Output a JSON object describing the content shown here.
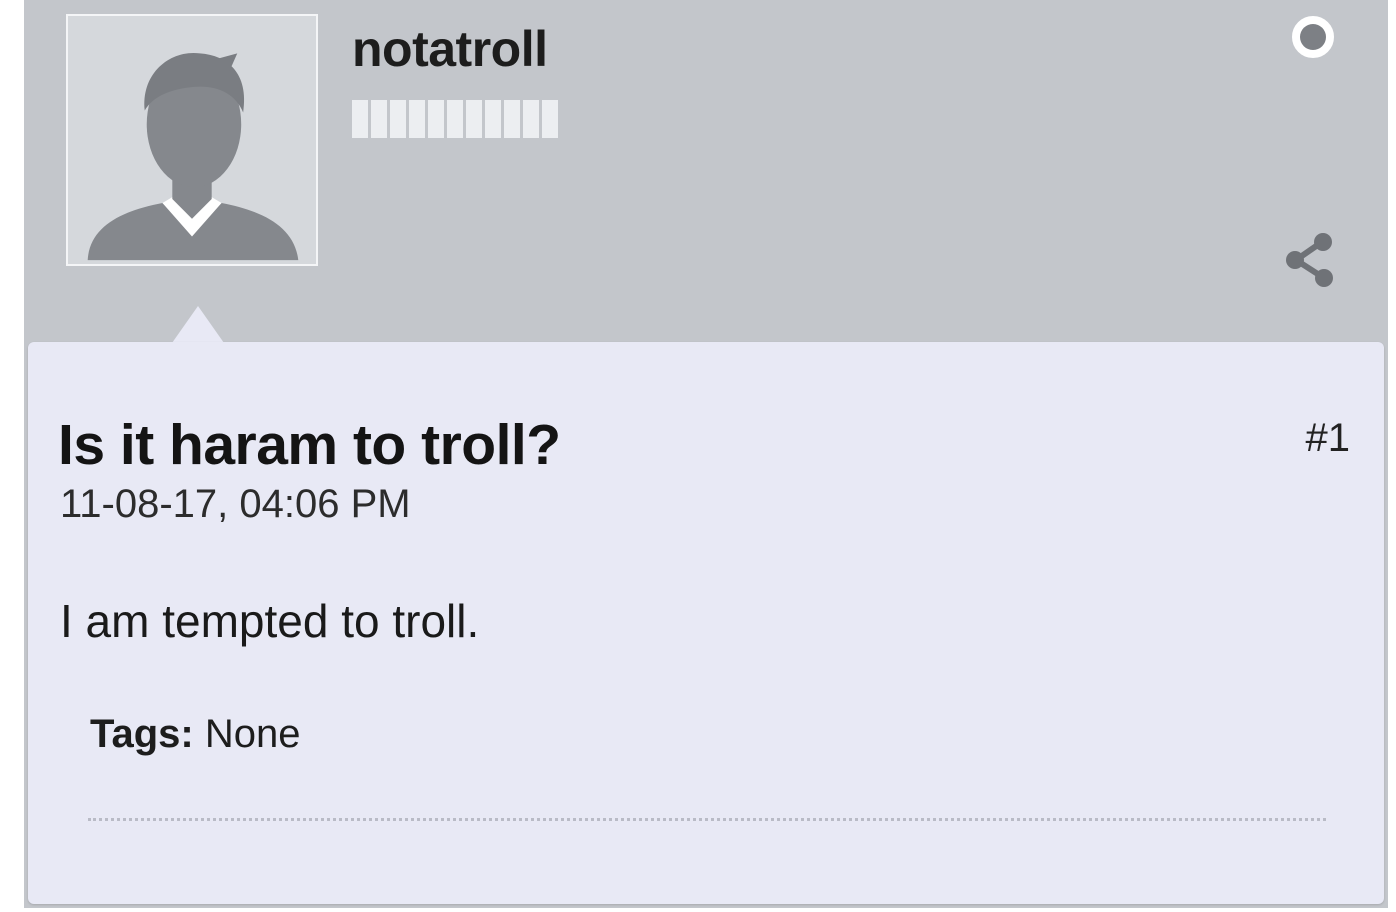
{
  "post": {
    "username": "notatroll",
    "reputation_segments": 11,
    "online_status": "offline",
    "icons": {
      "avatar": "default-user-silhouette-icon",
      "status": "status-dot-icon",
      "share": "share-icon"
    },
    "title": "Is it haram to troll?",
    "post_number": "#1",
    "date": "11-08-17, 04:06 PM",
    "content": "I am tempted to troll.",
    "tags_label": "Tags:",
    "tags_value": "None"
  },
  "colors": {
    "header_bg": "#c3c6cb",
    "body_bg": "#e8e9f5",
    "avatar_silhouette": "#85888d",
    "status_dot": "#7d8085"
  }
}
